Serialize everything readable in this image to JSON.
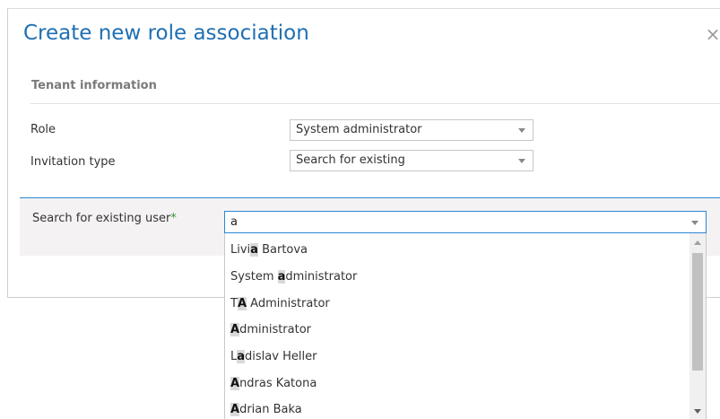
{
  "dialog": {
    "title": "Create new role association",
    "close_glyph": "×"
  },
  "section": {
    "title": "Tenant information"
  },
  "fields": {
    "role_label": "Role",
    "role_value": "System administrator",
    "invitation_label": "Invitation type",
    "invitation_value": "Search for existing"
  },
  "search": {
    "label": "Search for existing user",
    "required_mark": "*",
    "value": "a"
  },
  "results": [
    {
      "pre": "Livi",
      "hl": "a",
      "post": " Bartova"
    },
    {
      "pre": "System ",
      "hl": "a",
      "post": "dministrator"
    },
    {
      "pre": "T",
      "hl": "A",
      "post": " Administrator"
    },
    {
      "pre": "",
      "hl": "A",
      "post": "dministrator"
    },
    {
      "pre": "L",
      "hl": "a",
      "post": "dislav Heller"
    },
    {
      "pre": "",
      "hl": "A",
      "post": "ndras Katona"
    },
    {
      "pre": "",
      "hl": "A",
      "post": "drian Baka"
    }
  ],
  "colors": {
    "accent": "#1f6fb2",
    "focus_border": "#2b86d4",
    "required": "#2e9e3a",
    "highlight": "#d9d9d9"
  }
}
